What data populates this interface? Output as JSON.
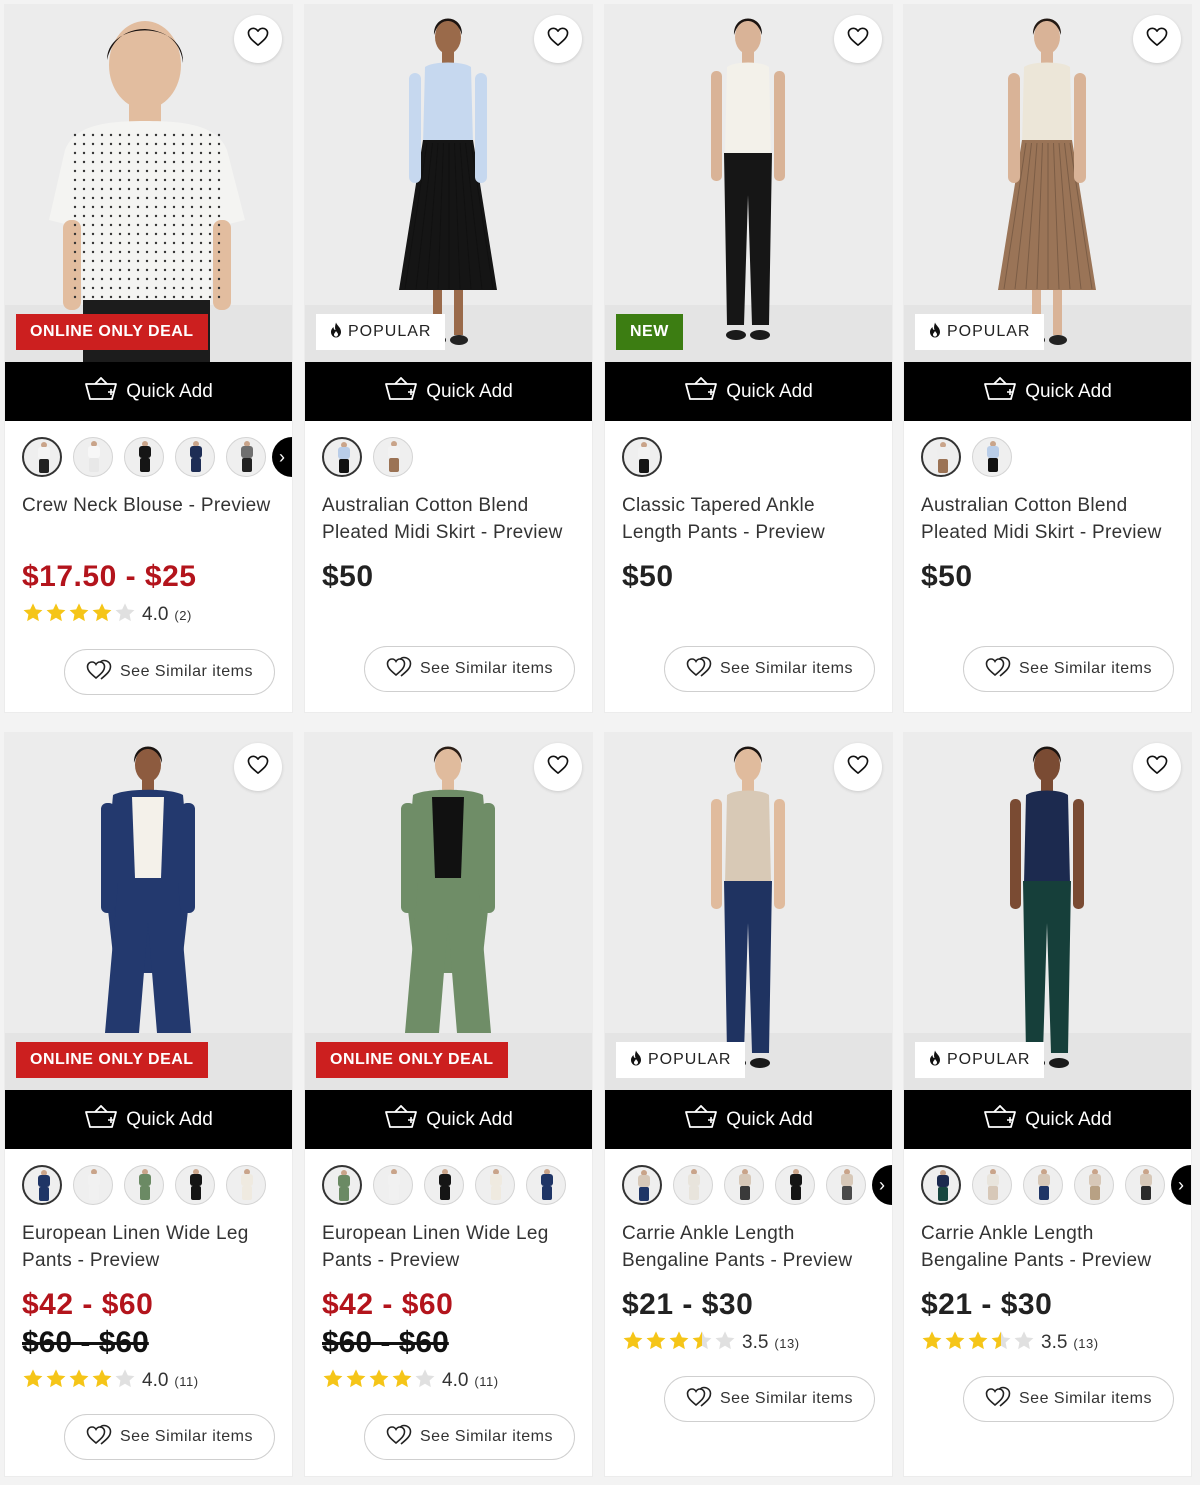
{
  "labels": {
    "quick_add": "Quick Add",
    "see_similar": "See Similar items"
  },
  "colors": {
    "sale_price": "#b3141c",
    "deal_badge": "#cc1f1f",
    "new_badge": "#3c7d12",
    "star": "#f5c518"
  },
  "icons": {
    "wishlist": "heart-icon",
    "quick_add": "basket-icon",
    "similar": "similar-hearts-icon",
    "popular": "flame-icon",
    "more_colors": "chevron-right-icon"
  },
  "products": [
    {
      "name": "Crew Neck Blouse - Preview",
      "badge": {
        "type": "deal",
        "text": "ONLINE ONLY DEAL"
      },
      "price": "$17.50 - $25",
      "price_sale": true,
      "was_price": "",
      "rating": {
        "value": "4.0",
        "stars": 4.0,
        "count": "(2)"
      },
      "more_colors": true,
      "swatches": [
        {
          "top": "#f4f4f4",
          "bottom": "#222222"
        },
        {
          "top": "#f7f7f7",
          "bottom": "#e8e8e8"
        },
        {
          "top": "#151515",
          "bottom": "#151515"
        },
        {
          "top": "#1e2d55",
          "bottom": "#1e2d55"
        },
        {
          "top": "#6f6f6f",
          "bottom": "#222222"
        }
      ],
      "figure": {
        "top": "#f4f4f2",
        "bottom": "#1c1c1c",
        "skin": "#e2bd9f",
        "hair": "#1b1411",
        "shot": "closeup"
      }
    },
    {
      "name": "Australian Cotton Blend Pleated Midi Skirt - Preview",
      "badge": {
        "type": "popular",
        "text": "POPULAR"
      },
      "price": "$50",
      "price_sale": false,
      "was_price": "",
      "rating": null,
      "more_colors": false,
      "swatches": [
        {
          "top": "#b9cde8",
          "bottom": "#111111"
        },
        {
          "top": "#f2f2f2",
          "bottom": "#9b7355"
        }
      ],
      "figure": {
        "top": "#c6d8ef",
        "bottom": "#151515",
        "skin": "#9a6a4a",
        "hair": "#1b1411",
        "shot": "skirt"
      }
    },
    {
      "name": "Classic Tapered Ankle Length Pants - Preview",
      "badge": {
        "type": "new",
        "text": "NEW"
      },
      "price": "$50",
      "price_sale": false,
      "was_price": "",
      "rating": null,
      "more_colors": false,
      "swatches": [
        {
          "top": "#f2f2f2",
          "bottom": "#151515"
        }
      ],
      "figure": {
        "top": "#f3f1ea",
        "bottom": "#161616",
        "skin": "#d9b397",
        "hair": "#1b1411",
        "shot": "pants"
      }
    },
    {
      "name": "Australian Cotton Blend Pleated Midi Skirt - Preview",
      "badge": {
        "type": "popular",
        "text": "POPULAR"
      },
      "price": "$50",
      "price_sale": false,
      "was_price": "",
      "rating": null,
      "more_colors": false,
      "swatches": [
        {
          "top": "#eeeeee",
          "bottom": "#9b7355"
        },
        {
          "top": "#b9cde8",
          "bottom": "#111111"
        }
      ],
      "figure": {
        "top": "#ece6d8",
        "bottom": "#9a7457",
        "skin": "#d9b397",
        "hair": "#241a14",
        "shot": "skirt"
      }
    },
    {
      "name": "European Linen Wide Leg Pants - Preview",
      "badge": {
        "type": "deal",
        "text": "ONLINE ONLY DEAL"
      },
      "price": "$42 - $60",
      "price_sale": true,
      "was_price": "$60 - $60",
      "rating": {
        "value": "4.0",
        "stars": 4.0,
        "count": "(11)"
      },
      "more_colors": false,
      "swatches": [
        {
          "top": "#1f3566",
          "bottom": "#1f3566"
        },
        {
          "top": "#f1f1f1",
          "bottom": "#f1f1f1"
        },
        {
          "top": "#6b8a64",
          "bottom": "#6b8a64"
        },
        {
          "top": "#151515",
          "bottom": "#151515"
        },
        {
          "top": "#efeae0",
          "bottom": "#efeae0"
        }
      ],
      "figure": {
        "top": "#f4f1ea",
        "bottom": "#23396e",
        "skin": "#8d5b3f",
        "hair": "#1b1411",
        "shot": "wide",
        "jacket": "#23396e"
      }
    },
    {
      "name": "European Linen Wide Leg Pants - Preview",
      "badge": {
        "type": "deal",
        "text": "ONLINE ONLY DEAL"
      },
      "price": "$42 - $60",
      "price_sale": true,
      "was_price": "$60 - $60",
      "rating": {
        "value": "4.0",
        "stars": 4.0,
        "count": "(11)"
      },
      "more_colors": false,
      "swatches": [
        {
          "top": "#6b8a64",
          "bottom": "#6b8a64"
        },
        {
          "top": "#f1f1f1",
          "bottom": "#f1f1f1"
        },
        {
          "top": "#151515",
          "bottom": "#151515"
        },
        {
          "top": "#efeae0",
          "bottom": "#efeae0"
        },
        {
          "top": "#1f3566",
          "bottom": "#1f3566"
        }
      ],
      "figure": {
        "top": "#111111",
        "bottom": "#6f8d67",
        "skin": "#e0bb9d",
        "hair": "#2a1d16",
        "shot": "wide",
        "jacket": "#6f8d67"
      }
    },
    {
      "name": "Carrie Ankle Length Bengaline Pants - Preview",
      "badge": {
        "type": "popular",
        "text": "POPULAR"
      },
      "price": "$21 - $30",
      "price_sale": false,
      "was_price": "",
      "rating": {
        "value": "3.5",
        "stars": 3.5,
        "count": "(13)"
      },
      "more_colors": true,
      "swatches": [
        {
          "top": "#d7c8b8",
          "bottom": "#1f3566"
        },
        {
          "top": "#e8e4dc",
          "bottom": "#e8e4dc"
        },
        {
          "top": "#d7c8b8",
          "bottom": "#3a3a3a"
        },
        {
          "top": "#151515",
          "bottom": "#151515"
        },
        {
          "top": "#d7c8b8",
          "bottom": "#4a4a4a"
        }
      ],
      "figure": {
        "top": "#d8c9b6",
        "bottom": "#1f3361",
        "skin": "#e0bb9d",
        "hair": "#1b1411",
        "shot": "pants"
      }
    },
    {
      "name": "Carrie Ankle Length Bengaline Pants - Preview",
      "badge": {
        "type": "popular",
        "text": "POPULAR"
      },
      "price": "$21 - $30",
      "price_sale": false,
      "was_price": "",
      "rating": {
        "value": "3.5",
        "stars": 3.5,
        "count": "(13)"
      },
      "more_colors": true,
      "swatches": [
        {
          "top": "#1c2a4f",
          "bottom": "#17463f"
        },
        {
          "top": "#e8e4dc",
          "bottom": "#d7c8b8"
        },
        {
          "top": "#d7c8b8",
          "bottom": "#1f3566"
        },
        {
          "top": "#d7c8b8",
          "bottom": "#b8a184"
        },
        {
          "top": "#d7c8b8",
          "bottom": "#2b2b2b"
        }
      ],
      "figure": {
        "top": "#1c2a4f",
        "bottom": "#163f3a",
        "skin": "#7a4b33",
        "hair": "#1b1411",
        "shot": "pants"
      }
    }
  ]
}
